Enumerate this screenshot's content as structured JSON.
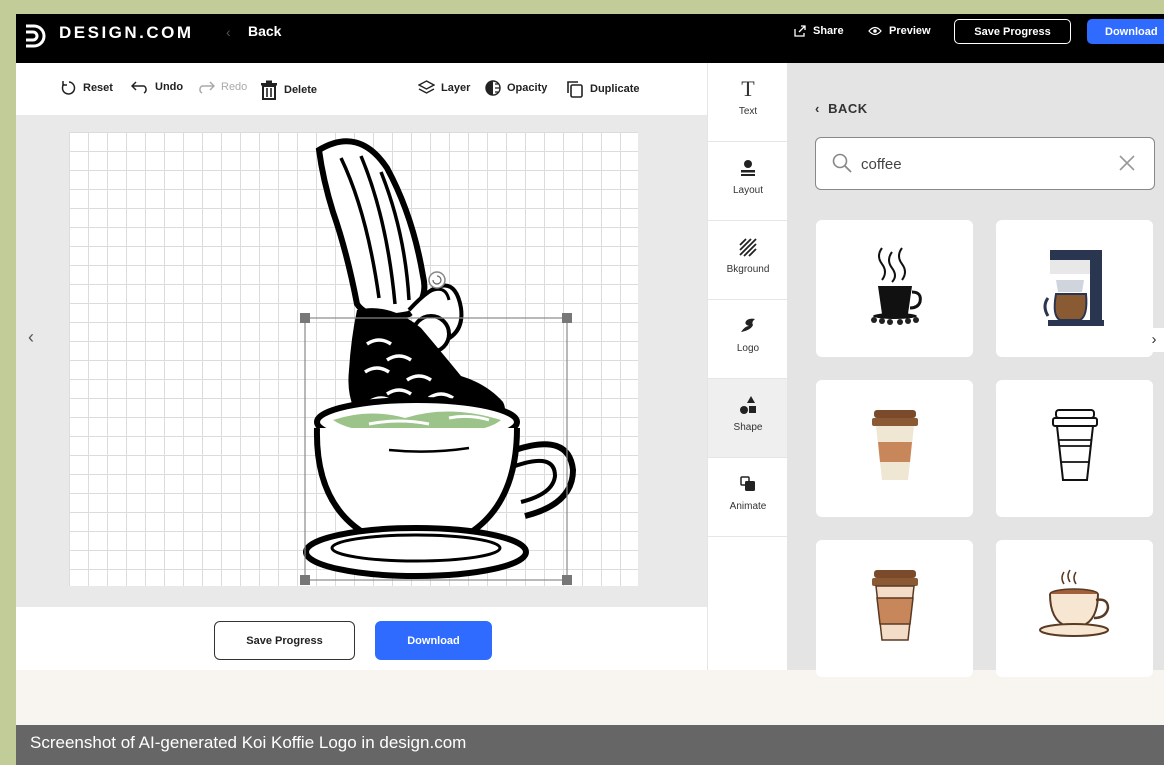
{
  "app": {
    "brand": "DESIGN.COM",
    "back_label": "Back"
  },
  "header_actions": {
    "share": "Share",
    "preview": "Preview",
    "save_progress": "Save Progress",
    "download": "Download"
  },
  "toolbar": {
    "reset": "Reset",
    "undo": "Undo",
    "redo": "Redo",
    "delete": "Delete",
    "layer": "Layer",
    "opacity": "Opacity",
    "duplicate": "Duplicate"
  },
  "side_tools": [
    {
      "label": "Text",
      "icon": "text-icon"
    },
    {
      "label": "Layout",
      "icon": "layout-icon"
    },
    {
      "label": "Bkground",
      "icon": "background-icon"
    },
    {
      "label": "Logo",
      "icon": "logo-icon"
    },
    {
      "label": "Shape",
      "icon": "shape-icon"
    },
    {
      "label": "Animate",
      "icon": "animate-icon"
    }
  ],
  "panel": {
    "back_label": "BACK",
    "search": {
      "value": "coffee"
    },
    "results": [
      {
        "icon": "steaming-cup-icon"
      },
      {
        "icon": "coffee-maker-icon"
      },
      {
        "icon": "takeaway-cup-icon"
      },
      {
        "icon": "outline-cup-icon"
      },
      {
        "icon": "paper-cup-icon"
      },
      {
        "icon": "teacup-icon"
      }
    ]
  },
  "footer": {
    "save_progress": "Save Progress",
    "download": "Download"
  },
  "caption": "Screenshot of AI-generated Koi Koffie Logo in design.com",
  "colors": {
    "accent": "#2f6bff",
    "topbar": "#000000",
    "matcha": "#9cc48a",
    "frame_border": "#c2cc98"
  }
}
